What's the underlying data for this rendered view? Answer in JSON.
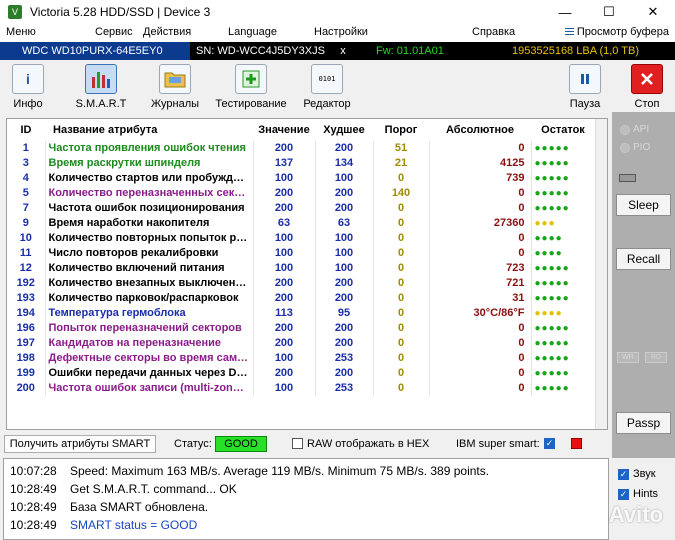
{
  "window": {
    "title": "Victoria 5.28 HDD/SSD | Device 3",
    "minimize": "—",
    "maximize": "☐",
    "close": "✕"
  },
  "menu": {
    "items": [
      "Меню",
      "Сервис",
      "Действия",
      "Language",
      "Настройки",
      "Справка"
    ],
    "buffer": "Просмотр буфера"
  },
  "device": {
    "model": "WDC WD10PURX-64E5EY0",
    "serial": "SN: WD-WCC4J5DY3XJS",
    "close": "x",
    "firmware": "Fw: 01.01A01",
    "lba": "1953525168 LBA (1,0 TB)"
  },
  "toolbar": {
    "info": "Инфо",
    "smart": "S.M.A.R.T",
    "logs": "Журналы",
    "test": "Тестирование",
    "editor": "Редактор",
    "pause": "Пауза",
    "stop": "Стоп",
    "info_glyph": "i",
    "editor_glyph": "0101"
  },
  "table": {
    "headers": {
      "id": "ID",
      "name": "Название атрибута",
      "value": "Значение",
      "worst": "Худшее",
      "threshold": "Порог",
      "absolute": "Абсолютное",
      "status": "Остаток"
    },
    "rows": [
      {
        "id": "1",
        "name": "Частота проявления ошибок чтения",
        "value": "200",
        "worst": "200",
        "thr": "51",
        "abs": "0",
        "status": "●●●●●",
        "color": "green"
      },
      {
        "id": "3",
        "name": "Время раскрутки шпинделя",
        "value": "137",
        "worst": "134",
        "thr": "21",
        "abs": "4125",
        "status": "●●●●●",
        "color": "green"
      },
      {
        "id": "4",
        "name": "Количество стартов или пробужде…",
        "value": "100",
        "worst": "100",
        "thr": "0",
        "abs": "739",
        "status": "●●●●●",
        "color": "black"
      },
      {
        "id": "5",
        "name": "Количество переназначенных сект…",
        "value": "200",
        "worst": "200",
        "thr": "140",
        "abs": "0",
        "status": "●●●●●",
        "color": "purple"
      },
      {
        "id": "7",
        "name": "Частота ошибок позиционирования",
        "value": "200",
        "worst": "200",
        "thr": "0",
        "abs": "0",
        "status": "●●●●●",
        "color": "black"
      },
      {
        "id": "9",
        "name": "Время наработки накопителя",
        "value": "63",
        "worst": "63",
        "thr": "0",
        "abs": "27360",
        "status": "●●●",
        "color": "black",
        "warn": true
      },
      {
        "id": "10",
        "name": "Количество повторных попыток ра…",
        "value": "100",
        "worst": "100",
        "thr": "0",
        "abs": "0",
        "status": "●●●●",
        "color": "black"
      },
      {
        "id": "11",
        "name": "Число повторов рекалибровки",
        "value": "100",
        "worst": "100",
        "thr": "0",
        "abs": "0",
        "status": "●●●●",
        "color": "black"
      },
      {
        "id": "12",
        "name": "Количество включений питания",
        "value": "100",
        "worst": "100",
        "thr": "0",
        "abs": "723",
        "status": "●●●●●",
        "color": "black"
      },
      {
        "id": "192",
        "name": "Количество внезапных выключени…",
        "value": "200",
        "worst": "200",
        "thr": "0",
        "abs": "721",
        "status": "●●●●●",
        "color": "black"
      },
      {
        "id": "193",
        "name": "Количество парковок/распарковок",
        "value": "200",
        "worst": "200",
        "thr": "0",
        "abs": "31",
        "status": "●●●●●",
        "color": "black"
      },
      {
        "id": "194",
        "name": "Температура гермоблока",
        "value": "113",
        "worst": "95",
        "thr": "0",
        "abs": "30°C/86°F",
        "status": "●●●●",
        "color": "blue",
        "warn": true
      },
      {
        "id": "196",
        "name": "Попыток переназначений секторов",
        "value": "200",
        "worst": "200",
        "thr": "0",
        "abs": "0",
        "status": "●●●●●",
        "color": "purple"
      },
      {
        "id": "197",
        "name": "Кандидатов на переназначение",
        "value": "200",
        "worst": "200",
        "thr": "0",
        "abs": "0",
        "status": "●●●●●",
        "color": "purple"
      },
      {
        "id": "198",
        "name": "Дефектные секторы во время само…",
        "value": "100",
        "worst": "253",
        "thr": "0",
        "abs": "0",
        "status": "●●●●●",
        "color": "purple"
      },
      {
        "id": "199",
        "name": "Ошибки передачи данных через DMA",
        "value": "200",
        "worst": "200",
        "thr": "0",
        "abs": "0",
        "status": "●●●●●",
        "color": "black"
      },
      {
        "id": "200",
        "name": "Частота ошибок записи (multi-zone …",
        "value": "100",
        "worst": "253",
        "thr": "0",
        "abs": "0",
        "status": "●●●●●",
        "color": "purple"
      }
    ]
  },
  "statusbar": {
    "get_smart": "Получить атрибуты SMART",
    "status_label": "Статус:",
    "status_value": "GOOD",
    "raw_hex": "RAW отображать в HEX",
    "ibm": "IBM super smart:",
    "check_glyph": "✓"
  },
  "right_panel": {
    "api": "API",
    "pio": "PIO",
    "sleep": "Sleep",
    "recall": "Recall",
    "passp": "Passp",
    "wr": "WR",
    "rd": "RD"
  },
  "log": [
    {
      "time": "10:07:28",
      "msg": "Speed: Maximum 163 MB/s. Average 119 MB/s. Minimum 75 MB/s. 389 points.",
      "blue": false
    },
    {
      "time": "10:28:49",
      "msg": "Get S.M.A.R.T. command... OK",
      "blue": false
    },
    {
      "time": "10:28:49",
      "msg": "База SMART обновлена.",
      "blue": false
    },
    {
      "time": "10:28:49",
      "msg": "SMART status = GOOD",
      "blue": true
    }
  ],
  "options": {
    "sound": "Звук",
    "hints": "Hints"
  },
  "watermark": "Avito"
}
